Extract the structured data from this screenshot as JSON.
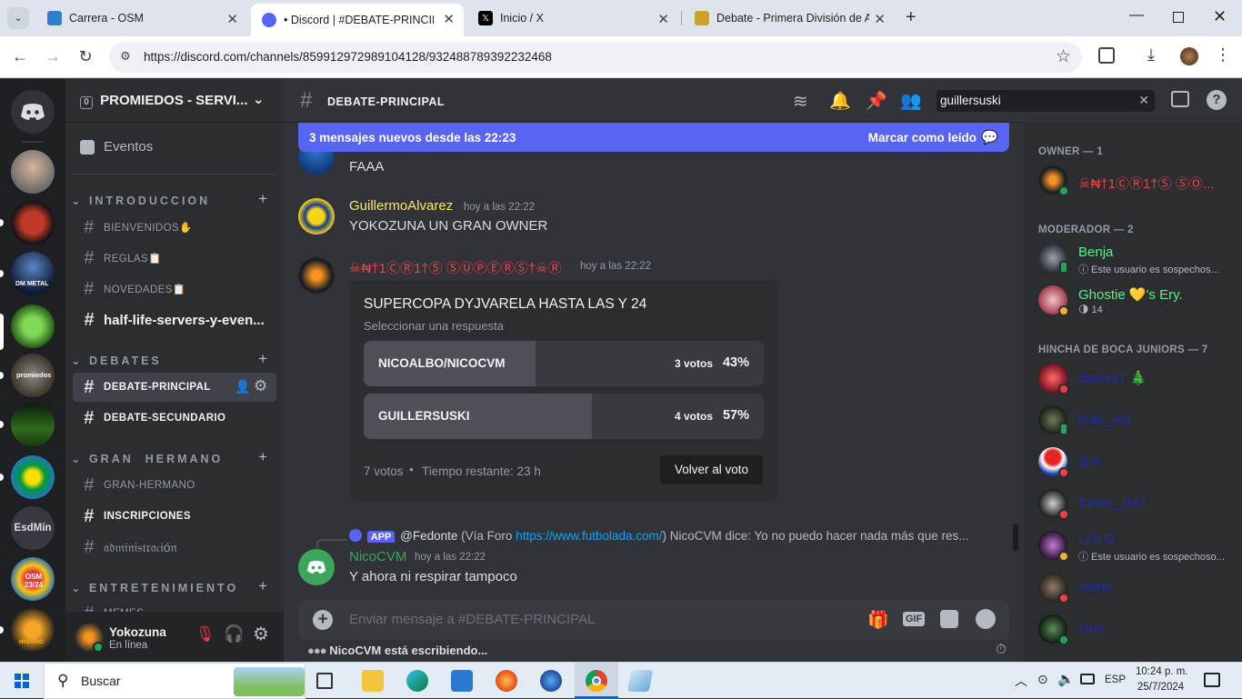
{
  "browser": {
    "tabs": [
      {
        "title": "Carrera - OSM"
      },
      {
        "title": "• Discord | #DEBATE-PRINCIPAL | PROMIEDOS"
      },
      {
        "title": "Inicio / X"
      },
      {
        "title": "Debate - Primera División de Argentina"
      }
    ],
    "url": "https://discord.com/channels/859912972989104128/932488789392232468"
  },
  "server": {
    "name": "PROMIEDOS - SERVI...",
    "badge": "0",
    "events_label": "Eventos",
    "guild_labels": [
      "DM METAL",
      "promiedos",
      "EsdMín",
      "OSM 23/24",
      "HISPANO"
    ]
  },
  "categories": [
    {
      "name": "INTRODUCCION",
      "channels": [
        "BIENVENIDOS✋",
        "REGLAS📋",
        "NOVEDADES📋",
        "half-life-servers-y-even..."
      ]
    },
    {
      "name": "DEBATES",
      "channels": [
        "DEBATE-PRINCIPAL",
        "DEBATE-SECUNDARIO"
      ]
    },
    {
      "name": "GRAN  HERMANO",
      "channels": [
        "GRAN-HERMANO",
        "INSCRIPCIONES",
        "𝔞𝔡𝔪𝔦𝔫𝔦𝔰𝔱𝔯𝔞𝔠𝔦ó𝔫"
      ]
    },
    {
      "name": "ENTRETENIMIENTO",
      "channels": [
        "MEMES"
      ]
    }
  ],
  "user": {
    "name": "Yokozuna",
    "status": "En línea"
  },
  "channel": {
    "name": "DEBATE-PRINCIPAL",
    "search_value": "guillersuski",
    "new_messages": "3 mensajes nuevos desde las 22:23",
    "mark_read": "Marcar como leído"
  },
  "messages": [
    {
      "text": "FAAA"
    },
    {
      "author": "GuillermoAlvarez",
      "time": "hoy a las 22:22",
      "text": "YOKOZUNA UN GRAN OWNER",
      "color": "#fee75c"
    },
    {
      "author": "☠₦†1ⒸⓇ1†Ⓢ ⓈⓊⓅⒺⓇⓈ†☠Ⓡ",
      "time": "hoy a las 22:22",
      "color": "#ed4245"
    },
    {
      "reply_badge": "APP",
      "reply_user": "@Fedonte",
      "reply_text_pre": " (Vía Foro ",
      "reply_link": "https://www.futbolada.com/",
      "reply_text_post": ") NicoCVM dice: Yo no puedo hacer nada más que res...",
      "author": "NicoCVM",
      "time": "hoy a las 22:22",
      "text": "Y ahora ni respirar tampoco",
      "color": "#3ba55c"
    }
  ],
  "poll": {
    "question": "SUPERCOPA DYJVARELA HASTA LAS Y 24",
    "subtitle": "Seleccionar una respuesta",
    "options": [
      {
        "label": "NICOALBO/NICOCVM",
        "votes": "3 votos",
        "percent": "43%",
        "fraction": 0.43
      },
      {
        "label": "GUILLERSUSKI",
        "votes": "4 votos",
        "percent": "57%",
        "fraction": 0.57
      }
    ],
    "total": "7 votos",
    "remaining": "Tiempo restante: 23 h",
    "vote_button": "Volver al voto"
  },
  "composer": {
    "placeholder": "Enviar mensaje a #DEBATE-PRINCIPAL",
    "typing": "NicoCVM está escribiendo..."
  },
  "members": {
    "groups": [
      {
        "header": "OWNER — 1",
        "members": [
          {
            "name": "☠₦†1ⒸⓇ1†Ⓢ ⓈⓄ...",
            "color": "#ed4245",
            "status": "online"
          }
        ]
      },
      {
        "header": "MODERADOR — 2",
        "members": [
          {
            "name": "Benja",
            "color": "#57f287",
            "sub": "ⓘ Este usuario es sospechos...",
            "status": "mobile"
          },
          {
            "name": "Ghostie 💛's Ery.",
            "color": "#57f287",
            "sub": "🌗 14",
            "status": "idle"
          }
        ]
      },
      {
        "header": "HINCHA DE BOCA JUNIORS — 7",
        "members": [
          {
            "name": "danix87 🎄",
            "color": "#1f2bb0",
            "status": "dnd"
          },
          {
            "name": "fede_esf",
            "color": "#1f2bb0",
            "status": "mobile"
          },
          {
            "name": "gus",
            "color": "#1f2bb0",
            "status": "dnd"
          },
          {
            "name": "Kimer_SX1",
            "color": "#1f2bb0",
            "status": "dnd"
          },
          {
            "name": "LOLO",
            "color": "#1f2bb0",
            "sub": "ⓘ Este usuario es sospechoso...",
            "status": "idle"
          },
          {
            "name": "manu",
            "color": "#1f2bb0",
            "status": "dnd"
          },
          {
            "name": "Gus",
            "color": "#1f2bb0",
            "status": "online"
          }
        ]
      }
    ]
  },
  "taskbar": {
    "search": "Buscar",
    "time": "10:24 p. m.",
    "date": "25/7/2024",
    "lang": "ESP"
  }
}
